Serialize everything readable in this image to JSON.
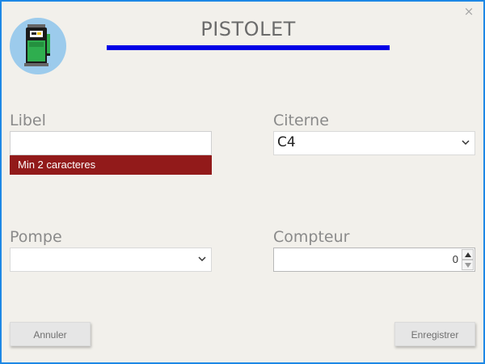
{
  "window": {
    "title": "PISTOLET",
    "close_glyph": "×",
    "accent_color": "#0000e6",
    "border_color": "#1e88e5",
    "logo_icon": "fuel-pump-icon"
  },
  "form": {
    "libel": {
      "label": "Libel",
      "value": "",
      "error": "Min 2 caracteres",
      "error_color": "#921a1a"
    },
    "citerne": {
      "label": "Citerne",
      "selected": "C4"
    },
    "pompe": {
      "label": "Pompe",
      "selected": ""
    },
    "compteur": {
      "label": "Compteur",
      "value": "0"
    }
  },
  "actions": {
    "cancel_label": "Annuler",
    "save_label": "Enregistrer"
  }
}
